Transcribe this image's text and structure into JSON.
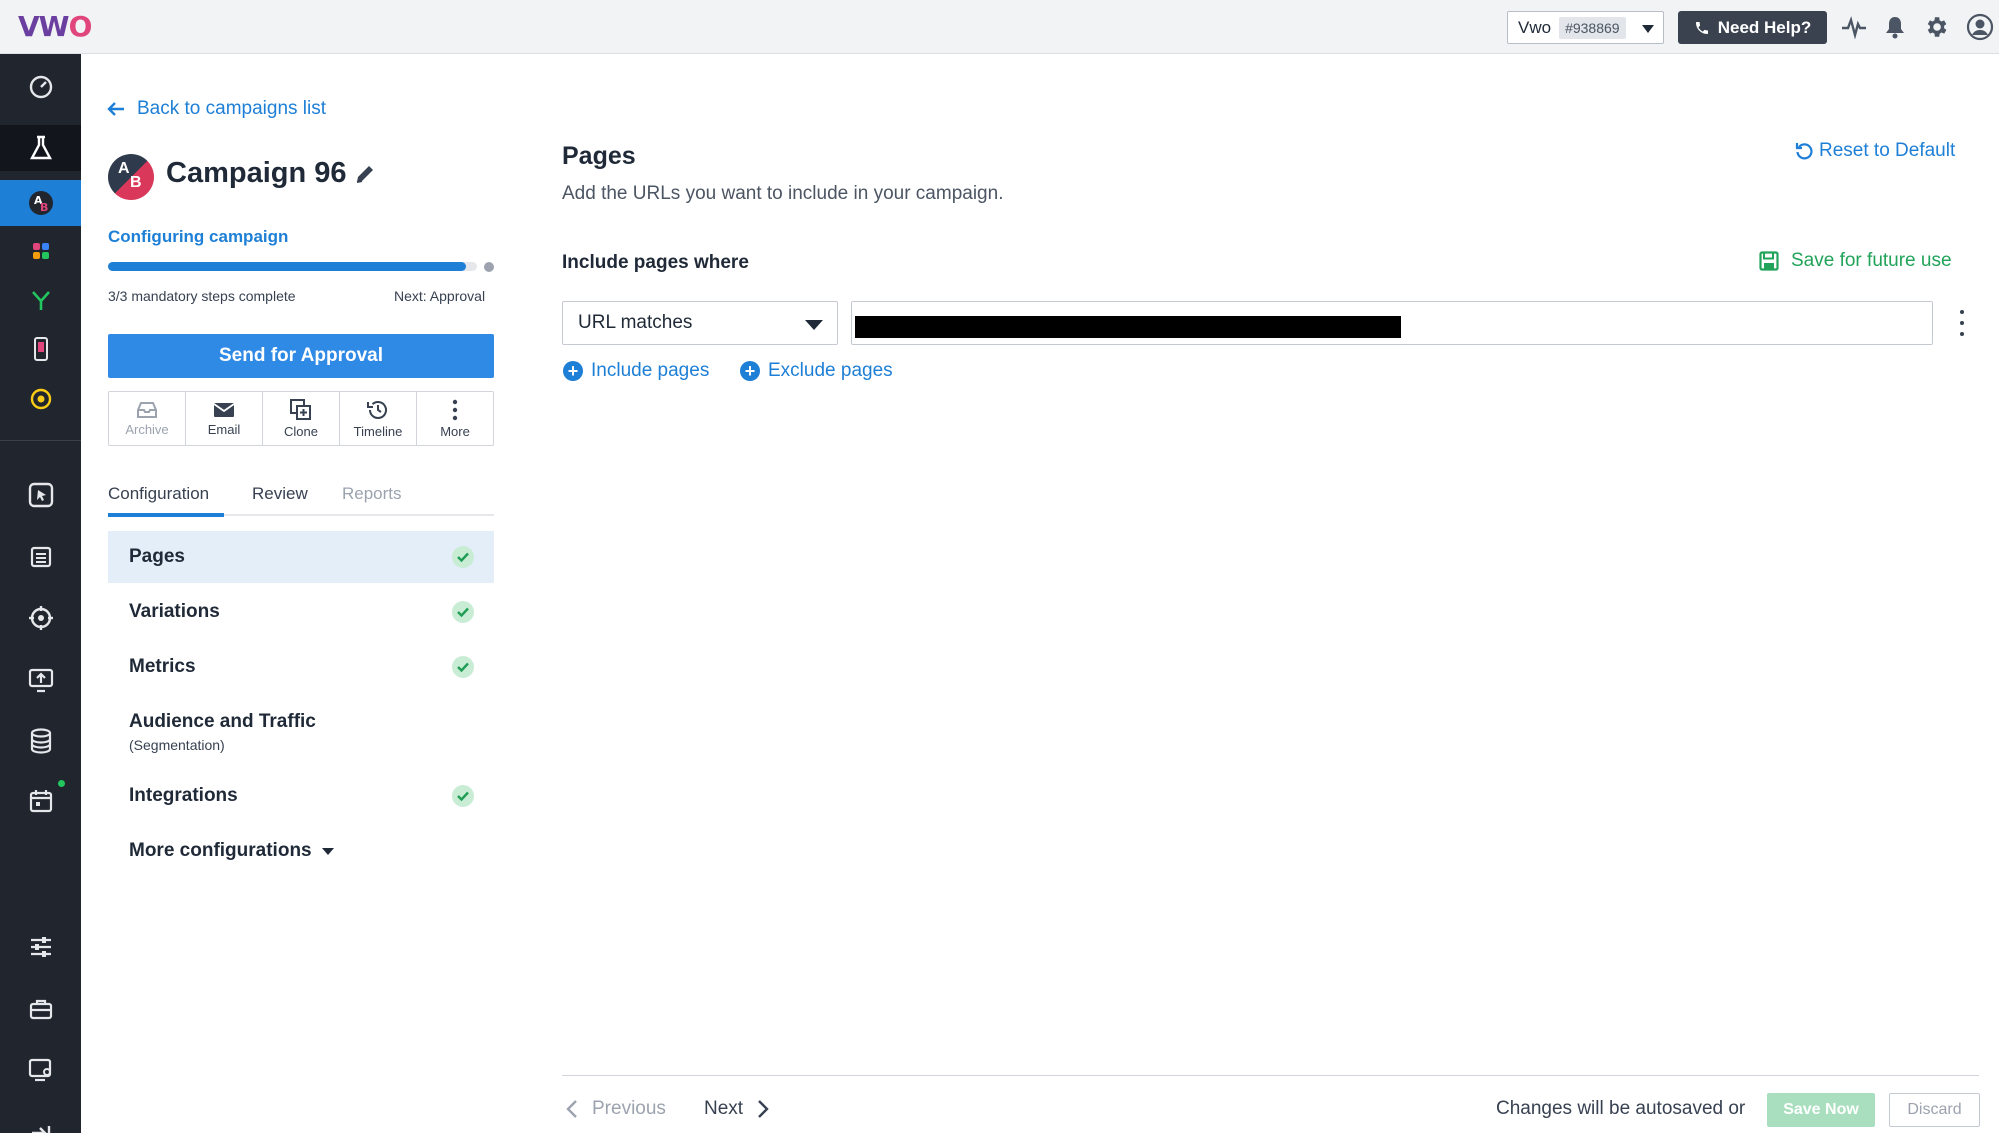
{
  "topbar": {
    "logo_text": "VWO",
    "account_name": "Vwo",
    "account_id": "#938869",
    "help_label": "Need Help?",
    "icons": [
      "activity-icon",
      "bell-icon",
      "gear-icon",
      "user-icon"
    ]
  },
  "rail": {
    "items": [
      "dashboard-icon",
      "testing-icon",
      "ab-test-icon",
      "apps-icon",
      "split-icon",
      "mobile-icon",
      "insights-icon",
      "heatmap-icon",
      "forms-icon",
      "target-icon",
      "deploy-icon",
      "database-icon",
      "calendar-icon",
      "settings-sliders-icon",
      "briefcase-icon",
      "integrations-icon",
      "collapse-icon"
    ]
  },
  "left_panel": {
    "back_label": "Back to campaigns list",
    "avatar_letters": [
      "A",
      "B"
    ],
    "campaign_title": "Campaign 96",
    "configuring_label": "Configuring campaign",
    "progress_fraction": 0.97,
    "steps_complete": "3/3 mandatory steps complete",
    "next_step": "Next: Approval",
    "send_button": "Send for Approval",
    "actions": [
      {
        "label": "Archive",
        "icon": "archive-icon",
        "enabled": false
      },
      {
        "label": "Email",
        "icon": "email-icon",
        "enabled": true
      },
      {
        "label": "Clone",
        "icon": "clone-icon",
        "enabled": true
      },
      {
        "label": "Timeline",
        "icon": "history-icon",
        "enabled": true
      },
      {
        "label": "More",
        "icon": "more-vertical-icon",
        "enabled": true
      }
    ],
    "tabs": [
      {
        "label": "Configuration",
        "active": true
      },
      {
        "label": "Review",
        "active": false
      },
      {
        "label": "Reports",
        "active": false
      }
    ],
    "nav": [
      {
        "label": "Pages",
        "done": true,
        "selected": true
      },
      {
        "label": "Variations",
        "done": true,
        "selected": false
      },
      {
        "label": "Metrics",
        "done": true,
        "selected": false
      },
      {
        "label": "Audience and Traffic",
        "sub": "(Segmentation)",
        "done": false,
        "selected": false
      },
      {
        "label": "Integrations",
        "done": true,
        "selected": false
      },
      {
        "label": "More configurations",
        "done": false,
        "selected": false
      }
    ]
  },
  "main": {
    "heading": "Pages",
    "subheading": "Add the URLs you want to include in your campaign.",
    "reset_label": "Reset to Default",
    "include_where": "Include pages where",
    "save_future_label": "Save for future use",
    "url_match_type": "URL matches",
    "include_pages": "Include pages",
    "exclude_pages": "Exclude pages"
  },
  "footer": {
    "previous": "Previous",
    "next": "Next",
    "autosave_text": "Changes will be autosaved or",
    "save_now": "Save Now",
    "discard": "Discard"
  },
  "colors": {
    "accent": "#1e7fd6",
    "success": "#22a35a",
    "rail_bg": "#20252e"
  }
}
